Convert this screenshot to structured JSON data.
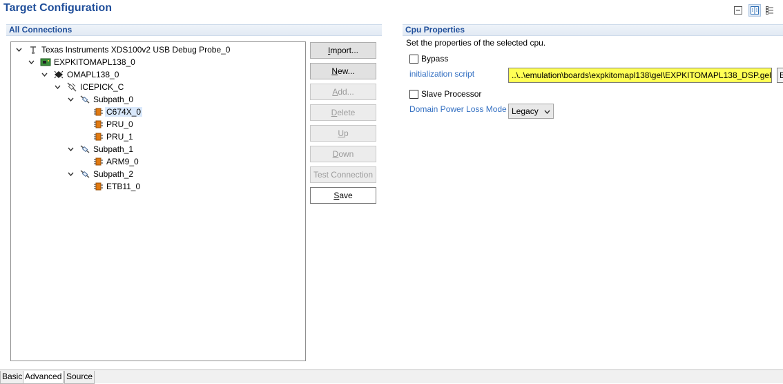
{
  "page_title": "Target Configuration",
  "toolbar": {
    "icons": [
      "collapse-icon",
      "split-view-icon",
      "outline-icon"
    ],
    "active": "split-view-icon"
  },
  "connections": {
    "header": "All Connections",
    "tree": [
      {
        "label": "Texas Instruments XDS100v2 USB Debug Probe_0",
        "icon": "probe-icon",
        "expanded": true
      },
      {
        "label": "EXPKITOMAPL138_0",
        "icon": "board-icon",
        "expanded": true
      },
      {
        "label": "OMAPL138_0",
        "icon": "chip-icon",
        "expanded": true
      },
      {
        "label": "ICEPICK_C",
        "icon": "router-icon",
        "expanded": true
      },
      {
        "label": "Subpath_0",
        "icon": "subpath-icon",
        "expanded": true
      },
      {
        "label": "C674X_0",
        "icon": "cpu-icon",
        "selected": true
      },
      {
        "label": "PRU_0",
        "icon": "cpu-icon"
      },
      {
        "label": "PRU_1",
        "icon": "cpu-icon"
      },
      {
        "label": "Subpath_1",
        "icon": "subpath-icon",
        "expanded": true
      },
      {
        "label": "ARM9_0",
        "icon": "cpu-icon"
      },
      {
        "label": "Subpath_2",
        "icon": "subpath-icon",
        "expanded": true
      },
      {
        "label": "ETB11_0",
        "icon": "cpu-icon"
      }
    ]
  },
  "buttons": {
    "import": {
      "label": "Import...",
      "mnemonic": "I",
      "rest": "mport..."
    },
    "new": {
      "label": "New...",
      "mnemonic": "N",
      "rest": "ew..."
    },
    "add": {
      "label": "Add...",
      "mnemonic": "A",
      "rest": "dd...",
      "enabled": false
    },
    "delete": {
      "label": "Delete",
      "mnemonic": "D",
      "rest": "elete",
      "enabled": false
    },
    "up": {
      "label": "Up",
      "mnemonic": "U",
      "rest": "p",
      "enabled": false
    },
    "down": {
      "label": "Down",
      "mnemonic": "D",
      "rest": "own",
      "enabled": false
    },
    "test_connection": {
      "label": "Test Connection",
      "enabled": false
    },
    "save": {
      "label": "Save",
      "mnemonic": "S",
      "rest": "ave"
    }
  },
  "cpu_properties": {
    "header": "Cpu Properties",
    "description": "Set the properties of the selected cpu.",
    "bypass_label": "Bypass",
    "bypass_checked": false,
    "init_script_label": "initialization script",
    "init_script_value": "..\\..\\emulation\\boards\\expkitomapl138\\gel\\EXPKITOMAPL138_DSP.gel",
    "browse_label": "B",
    "slave_label": "Slave Processor",
    "slave_checked": false,
    "domain_power_label": "Domain Power Loss Mode",
    "domain_power_value": "Legacy"
  },
  "tabs": [
    {
      "label": "Basic"
    },
    {
      "label": "Advanced",
      "active": true
    },
    {
      "label": "Source"
    }
  ],
  "colors": {
    "title": "#1f4e9a",
    "link": "#3470c2",
    "highlight": "#ffff55",
    "cpu_icon": "#e07a12"
  }
}
